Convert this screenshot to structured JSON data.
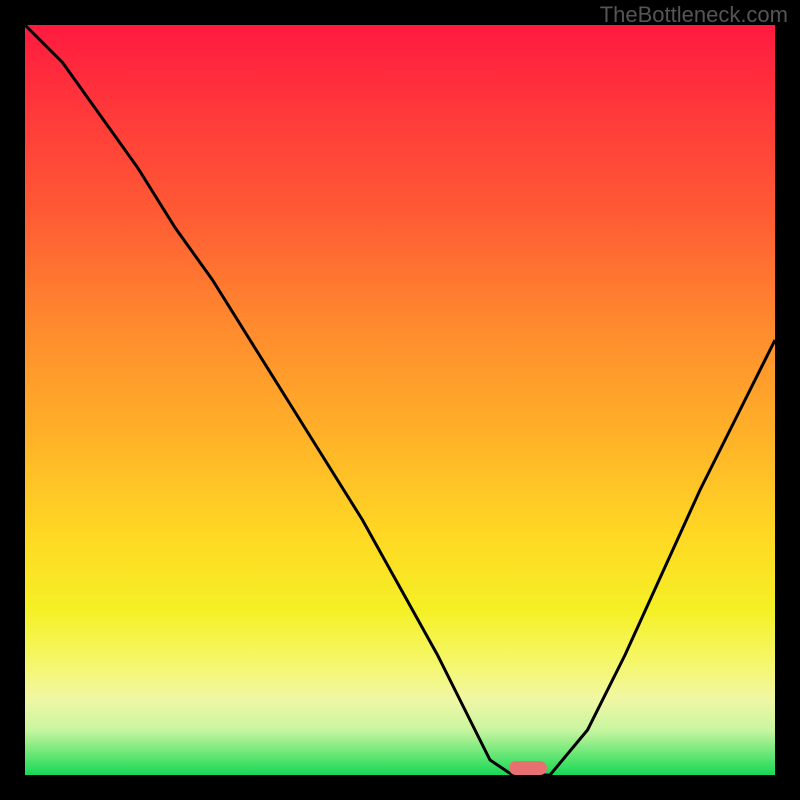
{
  "watermark": "TheBottleneck.com",
  "chart_data": {
    "type": "line",
    "title": "",
    "xlabel": "",
    "ylabel": "",
    "xlim": [
      0,
      100
    ],
    "ylim": [
      0,
      100
    ],
    "x": [
      0,
      5,
      10,
      15,
      20,
      25,
      30,
      35,
      40,
      45,
      50,
      55,
      60,
      62,
      65,
      70,
      75,
      80,
      85,
      90,
      95,
      100
    ],
    "values": [
      100,
      95,
      88,
      81,
      73,
      66,
      58,
      50,
      42,
      34,
      25,
      16,
      6,
      2,
      0,
      0,
      6,
      16,
      27,
      38,
      48,
      58
    ],
    "marker_x": 67,
    "marker_y": 1,
    "gradient_stops": [
      {
        "offset": 0,
        "color": "#ff1a40"
      },
      {
        "offset": 12,
        "color": "#ff3a3a"
      },
      {
        "offset": 25,
        "color": "#ff5a34"
      },
      {
        "offset": 40,
        "color": "#ff8a2e"
      },
      {
        "offset": 55,
        "color": "#ffb228"
      },
      {
        "offset": 68,
        "color": "#ffd824"
      },
      {
        "offset": 78,
        "color": "#f5f025"
      },
      {
        "offset": 85,
        "color": "#f5f76a"
      },
      {
        "offset": 90,
        "color": "#f0f7a5"
      },
      {
        "offset": 94,
        "color": "#c8f5a0"
      },
      {
        "offset": 97,
        "color": "#70e878"
      },
      {
        "offset": 100,
        "color": "#15d955"
      }
    ]
  }
}
